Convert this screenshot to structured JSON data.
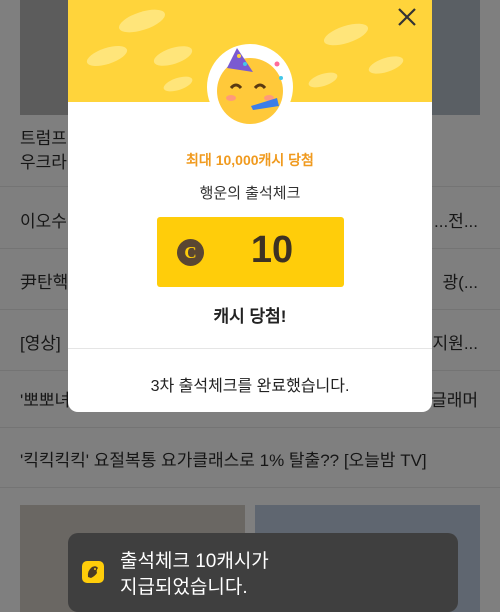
{
  "background": {
    "articles": [
      {
        "left": "트럼프",
        "right": ""
      },
      {
        "left": "우크라이",
        "right": ""
      },
      {
        "left": "이오수",
        "right": "...전..."
      },
      {
        "left": "尹탄핵",
        "right": "광(..."
      },
      {
        "left": "[영상]",
        "right": "지원..."
      },
      {
        "left": "'뽀뽀녀",
        "right": "글래머"
      },
      {
        "left": "'킥킥킥킥' 요절복통 요가클래스로 1% 탈출?? [오늘밤 TV]",
        "right": ""
      }
    ]
  },
  "modal": {
    "subtitle": "최대 10,000캐시 당첨",
    "title": "행운의 출석체크",
    "reward": {
      "coin_symbol": "C",
      "amount": "10"
    },
    "won_text": "캐시 당첨!",
    "completion_text": "3차 출석체크를 완료했습니다.",
    "accent_color": "#ffd43b",
    "reward_color": "#ffcd0a",
    "subtitle_color": "#f09a1e"
  },
  "toast": {
    "line1": "출석체크 10캐시가",
    "line2": "지급되었습니다."
  }
}
